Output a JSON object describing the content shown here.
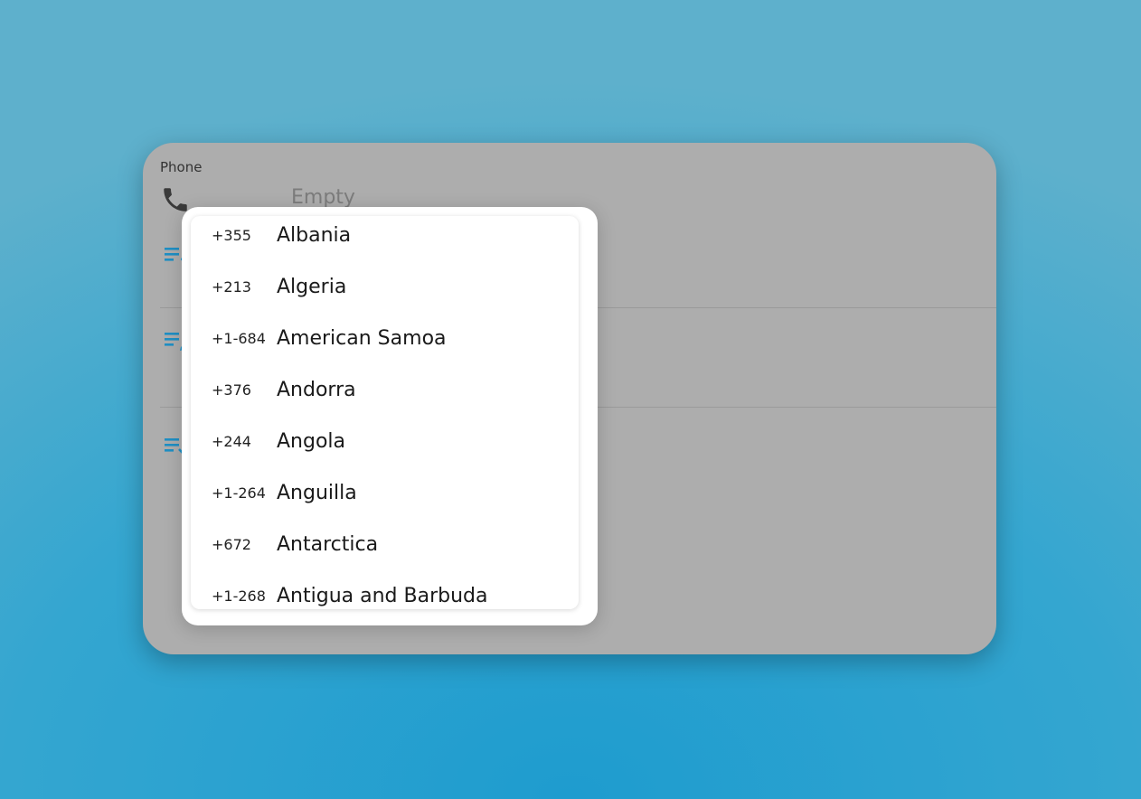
{
  "phone_field": {
    "label": "Phone",
    "value_placeholder": "Empty"
  },
  "colors": {
    "accent": "#1f8fc4",
    "icon_dark": "#3a3a3a",
    "card_background": "#adadad"
  },
  "icons": {
    "phone": "phone-icon",
    "add": "playlist-add-icon",
    "edit": "playlist-edit-icon",
    "check": "playlist-check-icon"
  },
  "country_dropdown": {
    "items": [
      {
        "code": "+355",
        "name": "Albania"
      },
      {
        "code": "+213",
        "name": "Algeria"
      },
      {
        "code": "+1-684",
        "name": "American Samoa"
      },
      {
        "code": "+376",
        "name": "Andorra"
      },
      {
        "code": "+244",
        "name": "Angola"
      },
      {
        "code": "+1-264",
        "name": "Anguilla"
      },
      {
        "code": "+672",
        "name": "Antarctica"
      },
      {
        "code": "+1-268",
        "name": "Antigua and Barbuda"
      }
    ]
  }
}
